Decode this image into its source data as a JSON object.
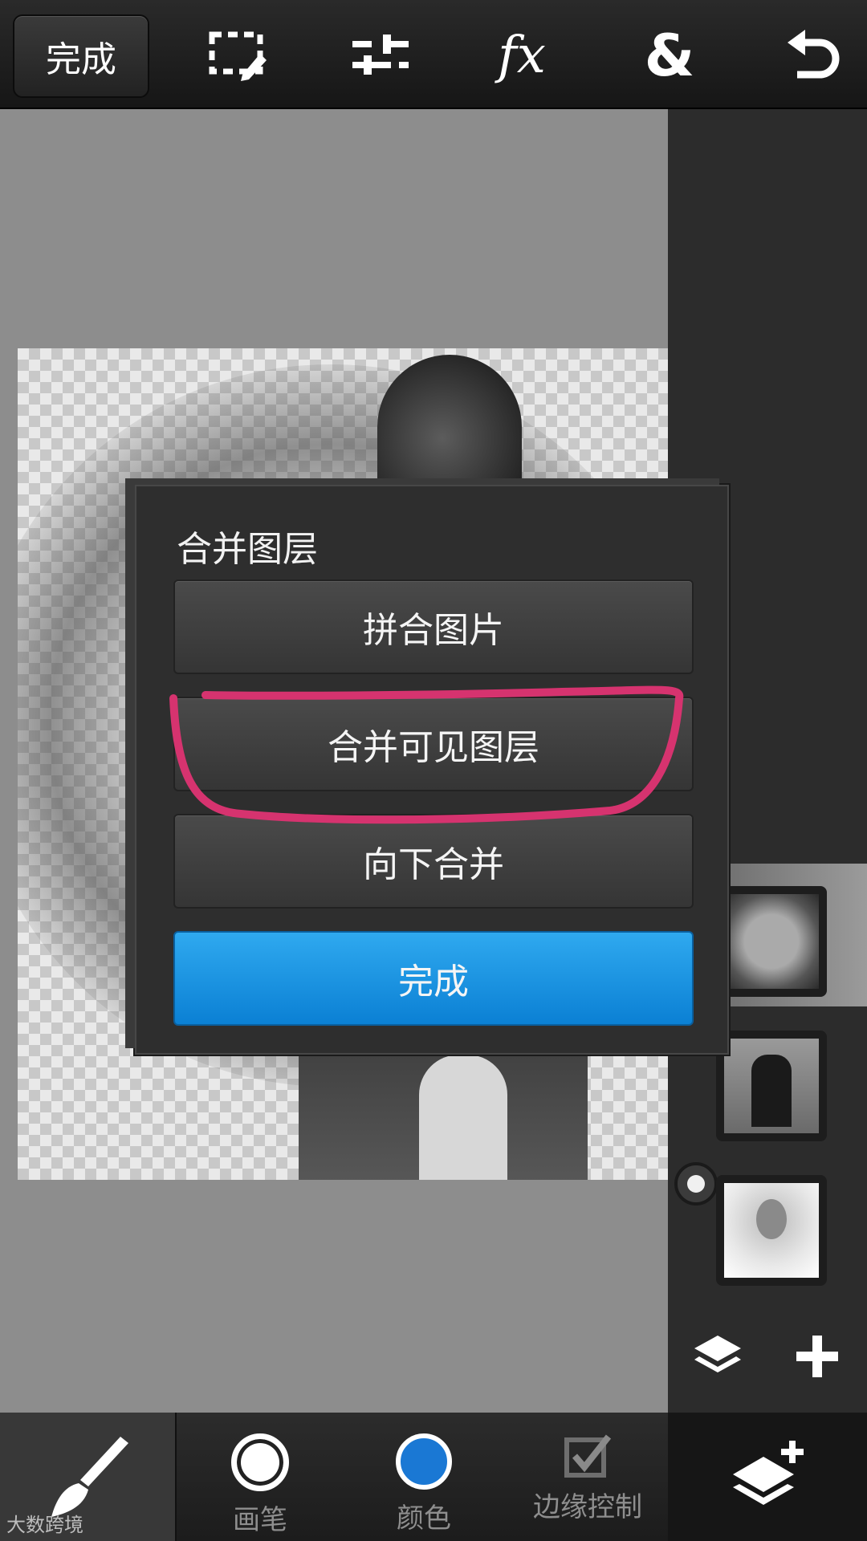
{
  "toolbar": {
    "done_label": "完成",
    "icons": [
      "selection-icon",
      "adjust-icon",
      "fx-icon",
      "blend-icon",
      "undo-icon"
    ],
    "fx_text": "fx",
    "amp_text": "&"
  },
  "dialog": {
    "title": "合并图层",
    "buttons": {
      "flatten": "拼合图片",
      "merge_visible": "合并可见图层",
      "merge_down": "向下合并",
      "done": "完成"
    }
  },
  "layers": {
    "selected_index": 2,
    "count": 3
  },
  "bottom_bar": {
    "brush_label": "画笔",
    "color_label": "颜色",
    "edge_label": "边缘控制"
  },
  "watermark": "大数跨境",
  "colors": {
    "accent": "#1a8ee0",
    "annotation": "#d6336f",
    "selected_color": "#1a78d4"
  }
}
